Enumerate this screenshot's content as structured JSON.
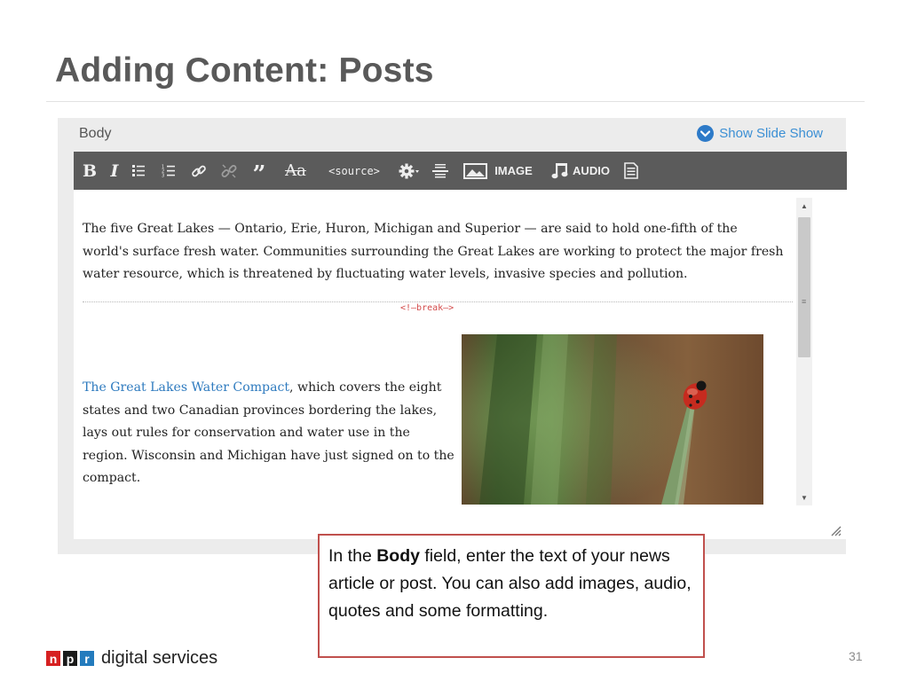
{
  "slide": {
    "title": "Adding Content: Posts",
    "page_number": "31"
  },
  "editor": {
    "field_label": "Body",
    "show_slideshow_label": "Show Slide Show",
    "toolbar": {
      "bold": "B",
      "italic": "I",
      "quote": "”",
      "strikethrough": "Aa",
      "source": "<source>",
      "image": "IMAGE",
      "audio": "AUDIO"
    },
    "paragraph1": "The five Great Lakes — Ontario, Erie, Huron, Michigan and Superior — are said to hold one-fifth of the world's surface fresh water. Communities surrounding the Great Lakes are working to protect the major fresh water resource, which is threatened by fluctuating water levels, invasive species and pollution.",
    "break_marker": "<!—break—>",
    "paragraph2_link": "The Great Lakes Water Compact",
    "paragraph2_rest": ", which covers the eight states and two Canadian provinces bordering the lakes, lays out rules for conservation and water use in the region. Wisconsin and Michigan have just signed on to the compact."
  },
  "callout": {
    "before": "In the ",
    "bold": "Body",
    "after": " field, enter the text of your news article or post. You can also add images, audio, quotes and some formatting."
  },
  "footer": {
    "logo_letters": [
      "n",
      "p",
      "r"
    ],
    "logo_colors": [
      "#d62021",
      "#1a1a1a",
      "#237bbd"
    ],
    "logo_text": "digital services"
  },
  "colors": {
    "toolbar_bg": "#5b5b5b",
    "link": "#2f7bbf",
    "callout_border": "#c0504d",
    "break_marker": "#d34a4a"
  }
}
